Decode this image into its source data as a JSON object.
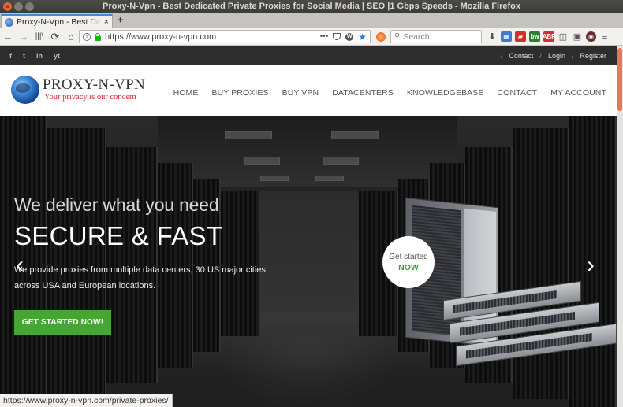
{
  "window": {
    "title": "Proxy-N-Vpn - Best Dedicated Private Proxies for Social Media | SEO |1 Gbps Speeds - Mozilla Firefox"
  },
  "tab": {
    "title": "Proxy-N-Vpn - Best Dedicated Private Proxies for Social Media",
    "close": "×",
    "new_tab": "+"
  },
  "nav": {
    "back": "←",
    "forward": "→",
    "library": "|||\\",
    "reload": "⟳",
    "home": "⌂"
  },
  "urlbar": {
    "url": "https://www.proxy-n-vpn.com",
    "more": "•••"
  },
  "search": {
    "placeholder": "Search"
  },
  "toolbar_icons": [
    {
      "name": "download-icon",
      "label": "⬇",
      "color": "#555555"
    },
    {
      "name": "extension-puzzle-icon",
      "label": "▦",
      "color": "#3c7ad6"
    },
    {
      "name": "extension-red-icon",
      "label": "▰",
      "color": "#d32f2f"
    },
    {
      "name": "extension-bw-icon",
      "label": "bw",
      "color": "#2e7d32"
    },
    {
      "name": "adblock-icon",
      "label": "ABP",
      "color": "#d32f2f"
    },
    {
      "name": "sidebar-icon",
      "label": "◫",
      "color": "#555555"
    },
    {
      "name": "screenshot-icon",
      "label": "▣",
      "color": "#555555"
    },
    {
      "name": "profile-icon",
      "label": "◉",
      "color": "#6b2b2b"
    },
    {
      "name": "menu-icon",
      "label": "≡",
      "color": "#444444"
    }
  ],
  "site": {
    "topbar": {
      "social": [
        "f",
        "t",
        "in",
        "yt"
      ],
      "links": [
        "Contact",
        "Login",
        "Register"
      ],
      "separator": "/"
    },
    "logo": {
      "name": "PROXY-N-VPN",
      "tagline": "Your privacy is our concern"
    },
    "menu": [
      "HOME",
      "BUY PROXIES",
      "BUY VPN",
      "DATACENTERS",
      "KNOWLEDGEBASE",
      "CONTACT",
      "MY ACCOUNT"
    ],
    "hero": {
      "subtitle": "We deliver what you need",
      "title": "SECURE & FAST",
      "description": "We provide proxies from multiple data centers, 30 US major cities across USA and European locations.",
      "cta": "GET STARTED NOW!",
      "badge_line1": "Get started",
      "badge_line2": "NOW",
      "prev": "‹",
      "next": "›"
    }
  },
  "status": {
    "url": "https://www.proxy-n-vpn.com/private-proxies/"
  },
  "colors": {
    "accent_green": "#45a633",
    "logo_red": "#d8242a",
    "firefox_blue": "#3c8cd8"
  }
}
